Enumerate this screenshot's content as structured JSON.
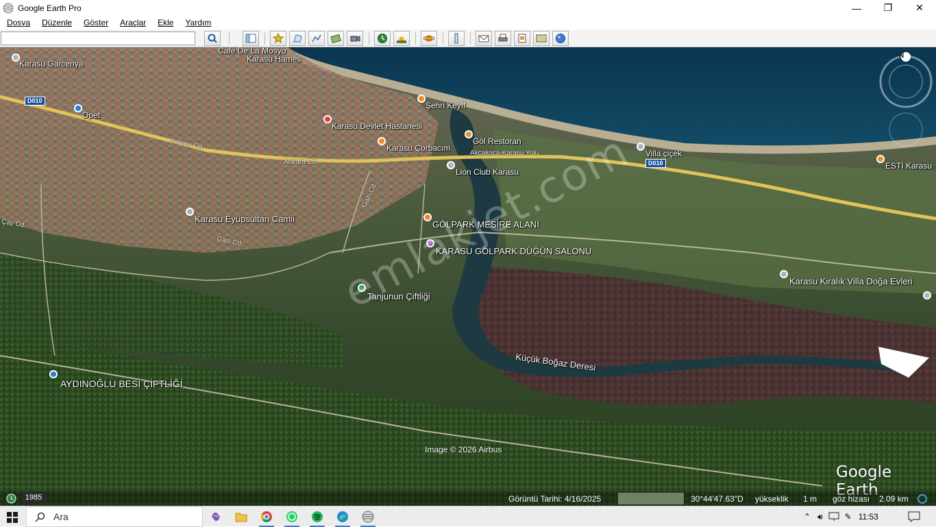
{
  "window": {
    "title": "Google Earth Pro",
    "minimize": "—",
    "restore": "❐",
    "close": "✕"
  },
  "menu": [
    "Dosya",
    "Düzenle",
    "Göster",
    "Araçlar",
    "Ekle",
    "Yardım"
  ],
  "search": {
    "value": "",
    "placeholder": ""
  },
  "toolbar_icons": [
    "search-icon",
    "sidebar-toggle-icon",
    "placemark-icon",
    "polygon-icon",
    "path-icon",
    "image-overlay-icon",
    "record-tour-icon",
    "historical-imagery-icon",
    "sunlight-icon",
    "planet-icon",
    "ruler-icon",
    "email-icon",
    "print-icon",
    "save-image-icon",
    "map-view-icon",
    "google-maps-icon"
  ],
  "map": {
    "places": {
      "cafe_de_la_mosyo": "Cafe De La Mosyo",
      "karasu_hames": "Karasu Hames",
      "karasu_garcenya": "Karasu Garcenya",
      "opet": "Opet",
      "karasu_devlet_hastanesi": "Karasu Devlet Hastanesi",
      "sehri_keyff": "Şehri Keyff",
      "gol_restoran": "Göl Restoran",
      "karasu_corbacim": "Karasu Çorbacım",
      "lion_club_karasu": "Lion Club Karasu",
      "villa_cicek": "Villa çiçek",
      "esti_karasu": "ESTİ Karasu",
      "karasu_eyupsultan_camii": "Karasu Eyüpsultan Camii",
      "golpark_mesire_alani": "GÖLPARK MESİRE ALANI",
      "karasu_golpark_dugun_salonu": "KARASU GÖLPARK DÜĞÜN SALONU",
      "tanjunun_ciftligi": "Tanjunun Çiftliği",
      "karasu_kiralik_villa": "Karasu Kiralık Villa Doğa Evleri",
      "kucuk_bogaz_deresi": "Küçük Boğaz Deresi",
      "aydinoglu_besi": "AYDINOĞLU BESİ ÇİFTLİĞİ"
    },
    "roads": {
      "ankara_cd_1": "Ankara Cd.",
      "ankara_cd_2": "Ankara Cd.",
      "akcakoca_karasu_yolu": "Akçakoca-Karasu Yolu",
      "gazi_cd_1": "Gazi Cd.",
      "gazi_cd_2": "Gazi Cd.",
      "cay_cd": "Çay Cd."
    },
    "shields": {
      "d010_west": "D010",
      "d010_east": "D010"
    },
    "watermark": "emlakjet.com",
    "credit": "Image © 2026 Airbus",
    "logo": "Google Earth",
    "compass_north": "N"
  },
  "status": {
    "year": "1985",
    "imagery_date": "Görüntü Tarihi: 4/16/2025",
    "coords": "30°44'47.63\"D",
    "elevation_label": "yükseklik",
    "elevation_value": "1 m",
    "eye_label": "göz hizası",
    "eye_value": "2.09 km"
  },
  "taskbar": {
    "search_placeholder": "Ara",
    "apps": [
      "copilot-icon",
      "file-explorer-icon",
      "chrome-icon",
      "whatsapp-icon",
      "spotify-icon",
      "edge-icon",
      "google-earth-icon"
    ],
    "time": "11:53"
  },
  "colors": {
    "sea": "#0c3a52",
    "highway": "#e0c35a",
    "river": "#1d3a43",
    "pin_orange": "#f08a24",
    "pin_blue": "#2b7bd8"
  }
}
